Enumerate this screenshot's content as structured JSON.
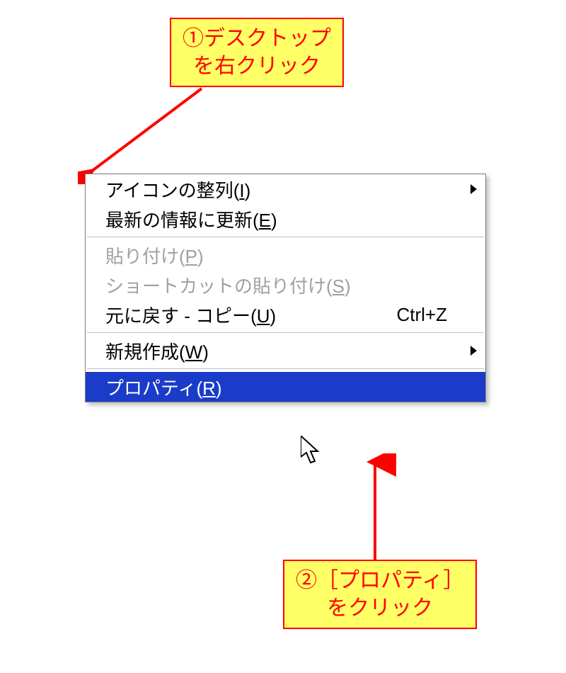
{
  "callouts": {
    "step1_line1": "①デスクトップ",
    "step1_line2": "を右クリック",
    "step2_line1": "②［プロパティ］",
    "step2_line2": "をクリック"
  },
  "menu": {
    "arrange_icons": {
      "pre": "アイコンの整列(",
      "accel": "I",
      "post": ")"
    },
    "refresh": {
      "pre": "最新の情報に更新(",
      "accel": "E",
      "post": ")"
    },
    "paste": {
      "pre": "貼り付け(",
      "accel": "P",
      "post": ")"
    },
    "paste_shortcut": {
      "pre": "ショートカットの貼り付け(",
      "accel": "S",
      "post": ")"
    },
    "undo": {
      "pre": "元に戻す - コピー(",
      "accel": "U",
      "post": ")",
      "shortcut": "Ctrl+Z"
    },
    "new": {
      "pre": "新規作成(",
      "accel": "W",
      "post": ")"
    },
    "properties": {
      "pre": "プロパティ(",
      "accel": "R",
      "post": ")"
    }
  }
}
